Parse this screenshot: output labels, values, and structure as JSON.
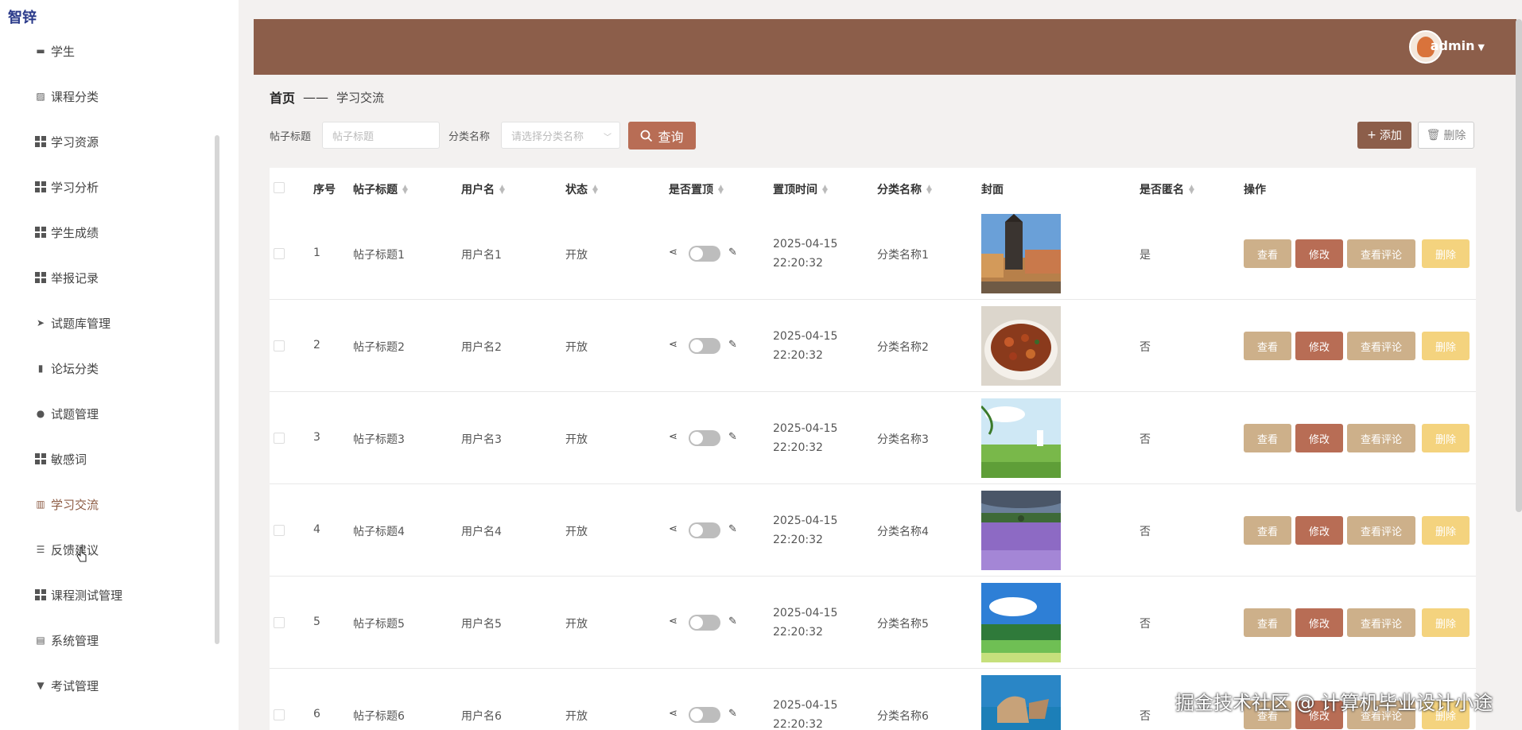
{
  "sidebar": {
    "brand": "智锌",
    "items": [
      {
        "label": "学生",
        "icon": "briefcase-icon"
      },
      {
        "label": "课程分类",
        "icon": "line-chart-icon"
      },
      {
        "label": "学习资源",
        "icon": "grid-icon"
      },
      {
        "label": "学习分析",
        "icon": "grid-icon"
      },
      {
        "label": "学生成绩",
        "icon": "grid-icon"
      },
      {
        "label": "举报记录",
        "icon": "grid-icon"
      },
      {
        "label": "试题库管理",
        "icon": "send-icon"
      },
      {
        "label": "论坛分类",
        "icon": "bar-chart-icon"
      },
      {
        "label": "试题管理",
        "icon": "pin-icon"
      },
      {
        "label": "敏感词",
        "icon": "grid-icon"
      },
      {
        "label": "学习交流",
        "icon": "book-icon"
      },
      {
        "label": "反馈建议",
        "icon": "sliders-icon"
      },
      {
        "label": "课程测试管理",
        "icon": "grid-icon"
      },
      {
        "label": "系统管理",
        "icon": "clipboard-icon"
      },
      {
        "label": "考试管理",
        "icon": "sign-icon"
      }
    ]
  },
  "header": {
    "username": "admin"
  },
  "breadcrumb": {
    "home": "首页",
    "separator": "——",
    "current": "学习交流"
  },
  "search": {
    "title_label": "帖子标题",
    "title_placeholder": "帖子标题",
    "category_label": "分类名称",
    "category_placeholder": "请选择分类名称",
    "query_button": "查询",
    "add_button": "添加",
    "delete_button": "删除"
  },
  "table": {
    "columns": [
      "序号",
      "帖子标题",
      "用户名",
      "状态",
      "是否置顶",
      "置顶时间",
      "分类名称",
      "封面",
      "是否匿名",
      "操作"
    ],
    "actions": {
      "view": "查看",
      "edit": "修改",
      "comments": "查看评论",
      "delete": "删除"
    },
    "rows": [
      {
        "index": "1",
        "title": "帖子标题1",
        "user": "用户名1",
        "status": "开放",
        "time": "2025-04-15 22:20:32",
        "category": "分类名称1",
        "anonymous": "是",
        "cover": "castle"
      },
      {
        "index": "2",
        "title": "帖子标题2",
        "user": "用户名2",
        "status": "开放",
        "time": "2025-04-15 22:20:32",
        "category": "分类名称2",
        "anonymous": "否",
        "cover": "food"
      },
      {
        "index": "3",
        "title": "帖子标题3",
        "user": "用户名3",
        "status": "开放",
        "time": "2025-04-15 22:20:32",
        "category": "分类名称3",
        "anonymous": "否",
        "cover": "meadow"
      },
      {
        "index": "4",
        "title": "帖子标题4",
        "user": "用户名4",
        "status": "开放",
        "time": "2025-04-15 22:20:32",
        "category": "分类名称4",
        "anonymous": "否",
        "cover": "lavender"
      },
      {
        "index": "5",
        "title": "帖子标题5",
        "user": "用户名5",
        "status": "开放",
        "time": "2025-04-15 22:20:32",
        "category": "分类名称5",
        "anonymous": "否",
        "cover": "landscape"
      },
      {
        "index": "6",
        "title": "帖子标题6",
        "user": "用户名6",
        "status": "开放",
        "time": "2025-04-15 22:20:32",
        "category": "分类名称6",
        "anonymous": "否",
        "cover": "sea"
      }
    ]
  },
  "watermark": "掘金技术社区 @ 计算机毕业设计小途",
  "colors": {
    "brand": "#8c5e4a",
    "accent": "#b86d55",
    "view_button": "#cdb08a",
    "delete_button": "#f4d37e"
  }
}
